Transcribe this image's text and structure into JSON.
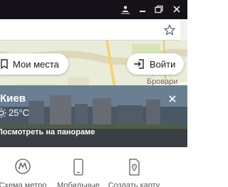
{
  "window_controls": {
    "user_icon": "user-icon",
    "minimize_icon": "minimize-icon",
    "restore_icon": "restore-icon",
    "close_icon": "close-icon"
  },
  "addressbar": {
    "bookmark_icon": "star-icon"
  },
  "map": {
    "place_labels": [
      "Бровари",
      "Бровари"
    ],
    "my_places_label": "Мои места",
    "login_label": "Войти",
    "colors": {
      "map_bg": "#e9ecd8",
      "pill_bg": "#ffffff"
    }
  },
  "weather": {
    "city": "Киев",
    "temperature": "25°C",
    "panorama_link": "Посмотреть на панораме",
    "weather_icon": "sun-icon",
    "close_icon": "close-icon"
  },
  "bottom": {
    "items": [
      {
        "label": "Схема метро",
        "icon": "metro-icon"
      },
      {
        "label": "Мобильные",
        "icon": "phone-icon"
      },
      {
        "label": "Создать карту",
        "icon": "map-pin-icon"
      }
    ],
    "metro_color": "#757575"
  }
}
